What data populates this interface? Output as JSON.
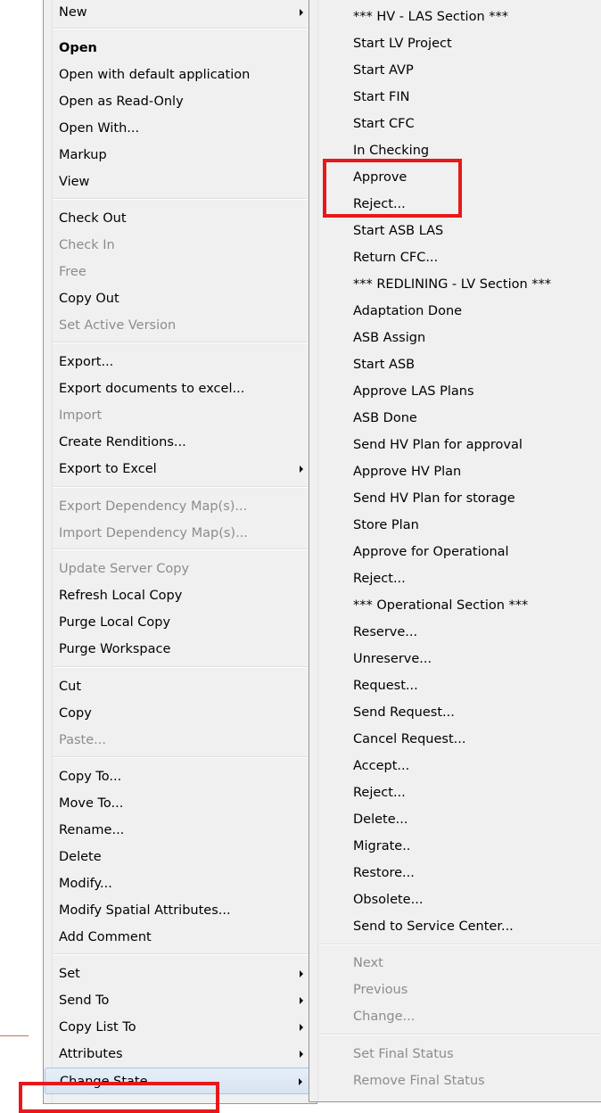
{
  "main_menu": {
    "items": [
      {
        "label": "New",
        "submenu": true
      },
      {
        "label": "Open",
        "bold": true
      },
      {
        "label": "Open with default application"
      },
      {
        "label": "Open as Read-Only"
      },
      {
        "label": "Open With..."
      },
      {
        "label": "Markup"
      },
      {
        "label": "View"
      },
      {
        "label": "Check Out"
      },
      {
        "label": "Check In",
        "disabled": true
      },
      {
        "label": "Free",
        "disabled": true
      },
      {
        "label": "Copy Out"
      },
      {
        "label": "Set Active Version",
        "disabled": true
      },
      {
        "label": "Export..."
      },
      {
        "label": "Export documents to excel..."
      },
      {
        "label": "Import",
        "disabled": true
      },
      {
        "label": "Create Renditions..."
      },
      {
        "label": "Export to Excel",
        "submenu": true
      },
      {
        "label": "Export Dependency Map(s)...",
        "disabled": true
      },
      {
        "label": "Import Dependency Map(s)...",
        "disabled": true
      },
      {
        "label": "Update Server Copy",
        "disabled": true
      },
      {
        "label": "Refresh Local Copy"
      },
      {
        "label": "Purge Local Copy"
      },
      {
        "label": "Purge Workspace"
      },
      {
        "label": "Cut"
      },
      {
        "label": "Copy"
      },
      {
        "label": "Paste...",
        "disabled": true
      },
      {
        "label": "Copy To..."
      },
      {
        "label": "Move To..."
      },
      {
        "label": "Rename..."
      },
      {
        "label": "Delete"
      },
      {
        "label": "Modify..."
      },
      {
        "label": "Modify Spatial Attributes..."
      },
      {
        "label": "Add Comment"
      },
      {
        "label": "Set",
        "submenu": true
      },
      {
        "label": "Send To",
        "submenu": true
      },
      {
        "label": "Copy List To",
        "submenu": true
      },
      {
        "label": "Attributes",
        "submenu": true
      },
      {
        "label": "Change State",
        "submenu": true,
        "hover": true
      }
    ]
  },
  "state_submenu": {
    "items": [
      {
        "label": "*** HV - LAS Section ***"
      },
      {
        "label": "Start LV Project"
      },
      {
        "label": "Start AVP"
      },
      {
        "label": "Start FIN"
      },
      {
        "label": "Start CFC"
      },
      {
        "label": "In Checking"
      },
      {
        "label": "Approve"
      },
      {
        "label": "Reject..."
      },
      {
        "label": "Start ASB LAS"
      },
      {
        "label": "Return CFC..."
      },
      {
        "label": "*** REDLINING - LV Section ***"
      },
      {
        "label": "Adaptation Done"
      },
      {
        "label": "ASB Assign"
      },
      {
        "label": "Start ASB"
      },
      {
        "label": "Approve LAS Plans"
      },
      {
        "label": "ASB Done"
      },
      {
        "label": "Send HV Plan for approval"
      },
      {
        "label": "Approve HV Plan"
      },
      {
        "label": "Send HV Plan for storage"
      },
      {
        "label": "Store Plan"
      },
      {
        "label": "Approve for Operational"
      },
      {
        "label": "Reject..."
      },
      {
        "label": "*** Operational Section ***"
      },
      {
        "label": "Reserve..."
      },
      {
        "label": "Unreserve..."
      },
      {
        "label": "Request..."
      },
      {
        "label": "Send Request..."
      },
      {
        "label": "Cancel Request..."
      },
      {
        "label": "Accept..."
      },
      {
        "label": "Reject..."
      },
      {
        "label": "Delete..."
      },
      {
        "label": "Migrate.."
      },
      {
        "label": "Restore..."
      },
      {
        "label": "Obsolete..."
      },
      {
        "label": "Send to Service Center..."
      },
      {
        "label": "Next",
        "disabled": true
      },
      {
        "label": "Previous",
        "disabled": true
      },
      {
        "label": "Change...",
        "disabled": true
      },
      {
        "label": "Set Final Status",
        "disabled": true
      },
      {
        "label": "Remove Final Status",
        "disabled": true
      }
    ]
  },
  "colors": {
    "annotation_red": "#e8181a",
    "menu_background": "#f0f0f0",
    "disabled_text": "#8c8c8c"
  }
}
